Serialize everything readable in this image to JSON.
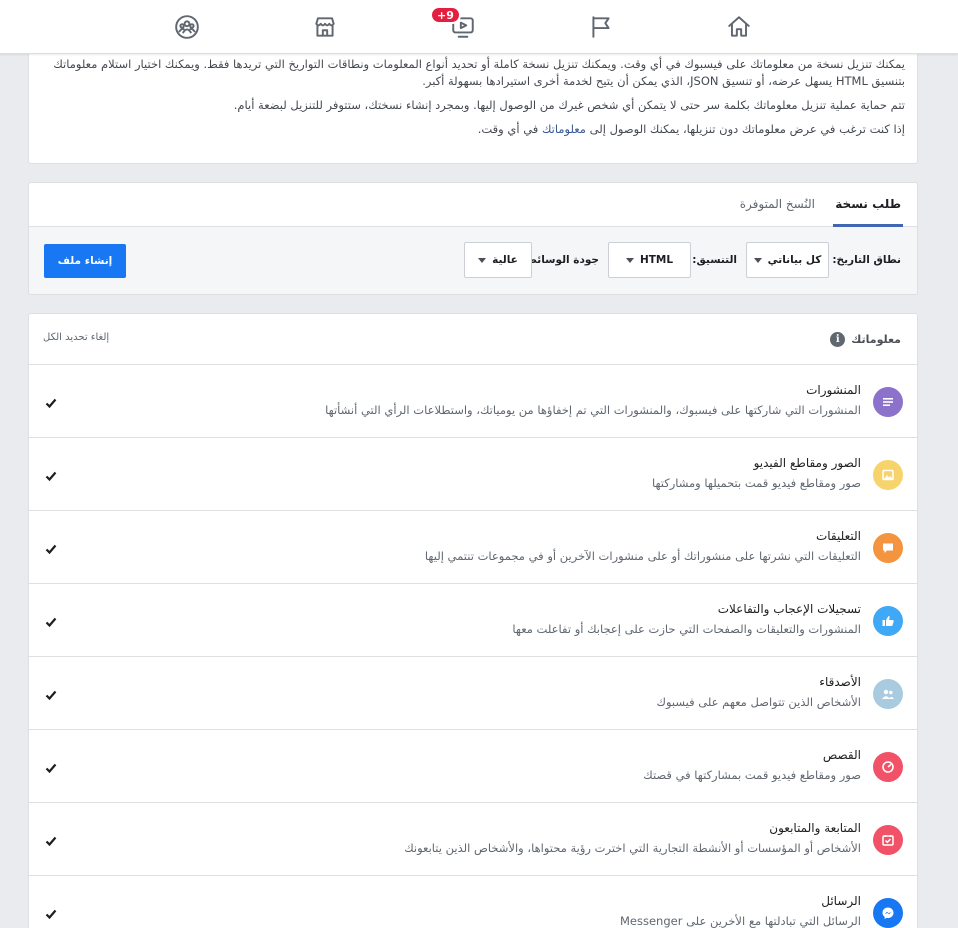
{
  "nav": {
    "badge": "+9",
    "icons": [
      "home-icon",
      "flag-icon",
      "watch-icon",
      "marketplace-icon",
      "groups-icon"
    ]
  },
  "intro": {
    "p1_line1": "يمكنك تنزيل نسخة من معلوماتك على فيسبوك في أي وقت. ويمكنك تنزيل نسخة كاملة أو تحديد أنواع المعلومات ونطاقات التواريخ التي تريدها فقط. ويمكنك اختيار استلام معلوماتك",
    "p1_line2": "بتنسيق HTML يسهل عرضه، أو تنسيق JSON، الذي يمكن أن يتيح لخدمة أخرى استيرادها بسهولة أكبر.",
    "p2": "تتم حماية عملية تنزيل معلوماتك بكلمة سر حتى لا يتمكن أي شخص غيرك من الوصول إليها. وبمجرد إنشاء نسختك، ستتوفر للتنزيل لبضعة أيام.",
    "p3_pre": "إذا كنت ترغب في عرض معلوماتك دون تنزيلها، يمكنك الوصول إلى",
    "p3_link": "معلوماتك",
    "p3_post": "في أي وقت."
  },
  "request": {
    "tab_active": "طلب نسخة",
    "tab_inactive": "النُسخ المتوفرة",
    "date_label": "نطاق التاريخ:",
    "date_value": "كل بياناتي",
    "format_label": "التنسيق:",
    "format_value": "HTML",
    "quality_label": "جودة الوسائط:",
    "quality_value": "عالية",
    "create_button": "إنشاء ملف"
  },
  "list": {
    "header": "معلوماتك",
    "deselect_all": "إلغاء تحديد الكل",
    "items": [
      {
        "title": "المنشورات",
        "desc": "المنشورات التي شاركتها على فيسبوك، والمنشورات التي تم إخفاؤها من يومياتك، واستطلاعات الرأي التي أنشأتها",
        "color": "#8c72cb",
        "icon": "posts-icon",
        "checked": true
      },
      {
        "title": "الصور ومقاطع الفيديو",
        "desc": "صور ومقاطع فيديو قمت بتحميلها ومشاركتها",
        "color": "#f7d36b",
        "icon": "photos-icon",
        "checked": true
      },
      {
        "title": "التعليقات",
        "desc": "التعليقات التي نشرتها على منشوراتك أو على منشورات الآخرين أو في مجموعات تنتمي إليها",
        "color": "#f5943f",
        "icon": "comments-icon",
        "checked": true
      },
      {
        "title": "تسجيلات الإعجاب والتفاعلات",
        "desc": "المنشورات والتعليقات والصفحات التي حازت على إعجابك أو تفاعلت معها",
        "color": "#3fa9f5",
        "icon": "like-icon",
        "checked": true
      },
      {
        "title": "الأصدقاء",
        "desc": "الأشخاص الذين تتواصل معهم على فيسبوك",
        "color": "#a9cbe0",
        "icon": "friends-icon",
        "checked": true
      },
      {
        "title": "القصص",
        "desc": "صور ومقاطع فيديو قمت بمشاركتها في قصتك",
        "color": "#f25268",
        "icon": "stories-icon",
        "checked": true
      },
      {
        "title": "المتابعة والمتابعون",
        "desc": "الأشخاص أو المؤسسات أو الأنشطة التجارية التي اخترت رؤية محتواها، والأشخاص الذين يتابعونك",
        "color": "#f25268",
        "icon": "following-icon",
        "checked": true
      },
      {
        "title": "الرسائل",
        "desc": "الرسائل التي تبادلتها مع الأخرين على Messenger",
        "color": "#1877f2",
        "icon": "messenger-icon",
        "checked": true
      }
    ]
  }
}
